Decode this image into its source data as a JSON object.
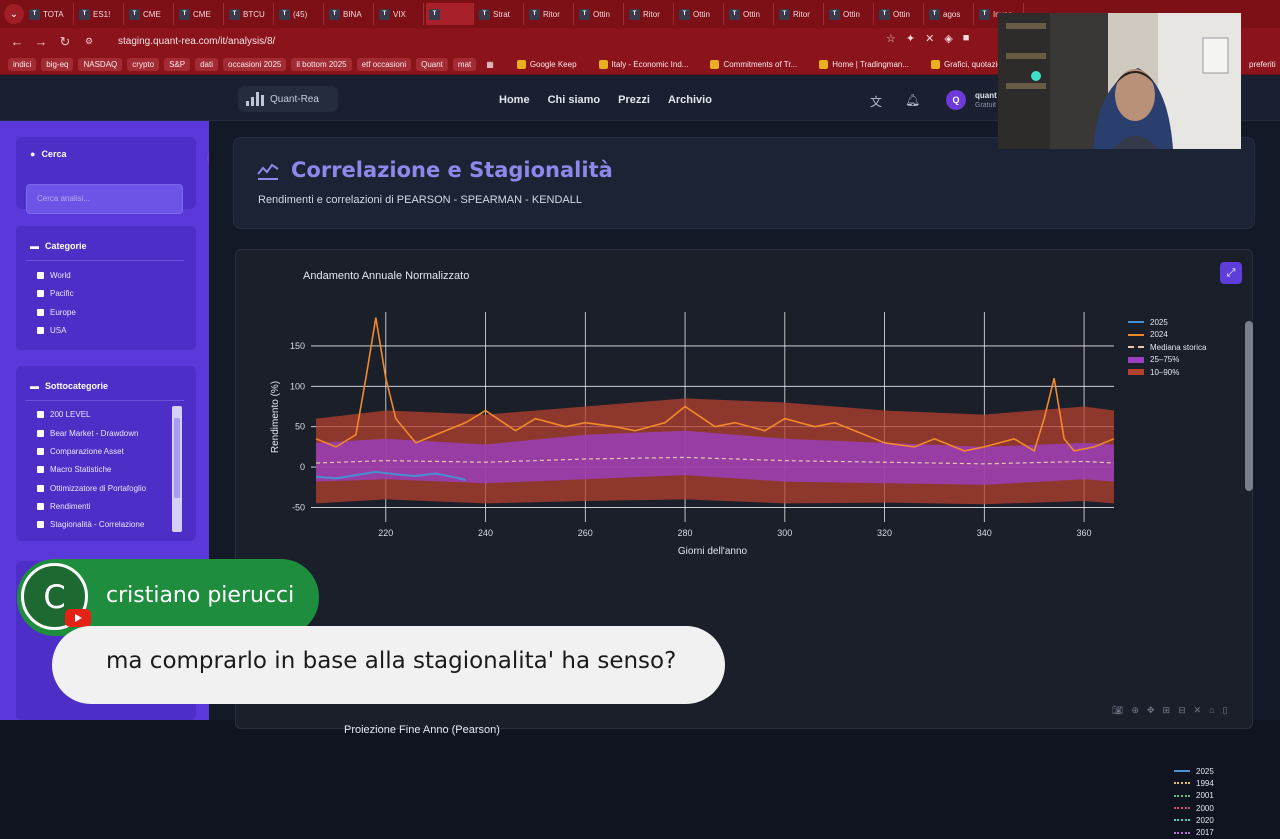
{
  "browser": {
    "tabs": [
      "TOTA",
      "ES1!",
      "CME",
      "CME",
      "BTCU",
      "(45)",
      "BINA",
      "VIX",
      "",
      "Strat",
      "Ritor",
      "Ottin",
      "Ritor",
      "Ottin",
      "Ottin",
      "Ritor",
      "Ottin",
      "Ottin",
      "agos",
      "Inves"
    ],
    "active_tab_index": 8,
    "url": "staging.quant-rea.com/it/analysis/8/",
    "bookmarks": [
      "indici",
      "big-eq",
      "NASDAQ",
      "crypto",
      "S&P",
      "dati",
      "occasioni 2025",
      "il bottom 2025",
      "etf occasioni",
      "Quant",
      "mat"
    ],
    "bookmark_links": [
      "Google Keep",
      "Italy - Economic Ind...",
      "Commitments of Tr...",
      "Home | Tradingman...",
      "Grafici, quotazioni e..."
    ],
    "preferiti": "preferiti"
  },
  "header": {
    "logo_text": "Quant-Rea",
    "nav": [
      "Home",
      "Chi siamo",
      "Prezzi",
      "Archivio"
    ],
    "avatar_letter": "Q",
    "user_name": "quant",
    "user_plan": "Gratuit"
  },
  "sidebar": {
    "search_title": "Cerca",
    "search_placeholder": "Cerca analisi...",
    "categories_title": "Categorie",
    "categories": [
      "World",
      "Pacific",
      "Europe",
      "USA"
    ],
    "subcategories_title": "Sottocategorie",
    "subcategories": [
      "200 LEVEL",
      "Bear Market - Drawdown",
      "Comparazione Asset",
      "Macro Statistiche",
      "Ottimizzatore di Portafoglio",
      "Rendimenti",
      "Stagionalità - Correlazione"
    ]
  },
  "page": {
    "title": "Correlazione e Stagionalità",
    "subtitle": "Rendimenti e correlazioni di PEARSON - SPEARMAN - KENDALL"
  },
  "chart_data": [
    {
      "type": "line",
      "title": "Andamento Annuale Normalizzato",
      "xlabel": "Giorni dell'anno",
      "ylabel": "Rendimento (%)",
      "xlim": [
        205,
        366
      ],
      "ylim": [
        -68,
        192
      ],
      "x_ticks": [
        220,
        240,
        260,
        280,
        300,
        320,
        340,
        360
      ],
      "y_ticks": [
        -50,
        0,
        50,
        100,
        150
      ],
      "legend": [
        {
          "name": "2025",
          "color": "#4a8fd0",
          "style": "solid"
        },
        {
          "name": "2024",
          "color": "#f08a2c",
          "style": "solid"
        },
        {
          "name": "Mediana storica",
          "color": "#e8c6b0",
          "style": "dash"
        },
        {
          "name": "25–75%",
          "color": "#9b3fc0",
          "style": "band"
        },
        {
          "name": "10–90%",
          "color": "#b5402f",
          "style": "band"
        }
      ],
      "series": [
        {
          "name": "2025",
          "x": [
            206,
            210,
            214,
            218,
            222,
            226,
            230,
            234,
            236
          ],
          "values": [
            -12,
            -14,
            -10,
            -6,
            -9,
            -11,
            -8,
            -13,
            -16
          ]
        },
        {
          "name": "2024",
          "x": [
            206,
            210,
            214,
            216,
            218,
            220,
            222,
            226,
            230,
            236,
            240,
            246,
            250,
            256,
            260,
            266,
            270,
            276,
            280,
            286,
            290,
            296,
            300,
            306,
            310,
            316,
            320,
            326,
            330,
            336,
            340,
            346,
            350,
            352,
            354,
            356,
            358,
            362,
            366
          ],
          "values": [
            35,
            25,
            40,
            110,
            185,
            110,
            60,
            30,
            40,
            55,
            70,
            45,
            60,
            50,
            55,
            50,
            45,
            55,
            75,
            50,
            55,
            45,
            60,
            50,
            55,
            40,
            30,
            25,
            35,
            20,
            25,
            35,
            20,
            60,
            110,
            35,
            20,
            25,
            35
          ]
        },
        {
          "name": "Mediana storica",
          "x": [
            206,
            220,
            240,
            260,
            280,
            300,
            320,
            340,
            360,
            366
          ],
          "values": [
            5,
            8,
            6,
            10,
            12,
            8,
            6,
            4,
            7,
            5
          ]
        },
        {
          "name": "25–75%",
          "x": [
            206,
            220,
            240,
            260,
            280,
            300,
            320,
            340,
            360,
            366
          ],
          "low": [
            -18,
            -15,
            -20,
            -15,
            -10,
            -18,
            -20,
            -22,
            -15,
            -18
          ],
          "high": [
            30,
            35,
            28,
            40,
            45,
            35,
            30,
            25,
            30,
            28
          ]
        },
        {
          "name": "10–90%",
          "x": [
            206,
            220,
            240,
            260,
            280,
            300,
            320,
            340,
            360,
            366
          ],
          "low": [
            -45,
            -40,
            -45,
            -42,
            -40,
            -45,
            -44,
            -46,
            -42,
            -45
          ],
          "high": [
            60,
            70,
            65,
            75,
            85,
            80,
            70,
            65,
            75,
            70
          ]
        }
      ]
    },
    {
      "type": "line",
      "title": "Proiezione Fine Anno (Pearson)",
      "legend": [
        {
          "name": "2025",
          "color": "#4a8fd0",
          "style": "solid"
        },
        {
          "name": "1994",
          "color": "#e0c060",
          "style": "dot"
        },
        {
          "name": "2001",
          "color": "#5cc07a",
          "style": "dot"
        },
        {
          "name": "2000",
          "color": "#d84a6a",
          "style": "dot"
        },
        {
          "name": "2020",
          "color": "#4acfc0",
          "style": "dot"
        },
        {
          "name": "2017",
          "color": "#c06ad8",
          "style": "dot"
        }
      ]
    }
  ],
  "overlay": {
    "chat_avatar_letter": "C",
    "chat_user": "cristiano pierucci",
    "chat_message": "ma comprarlo in base alla stagionalita' ha senso?"
  },
  "colors": {
    "tabstrip": "#7d0f16",
    "sidebar": "#5b38d9",
    "accent_title": "#8c89ea",
    "chat_green": "#1f8d3e"
  }
}
